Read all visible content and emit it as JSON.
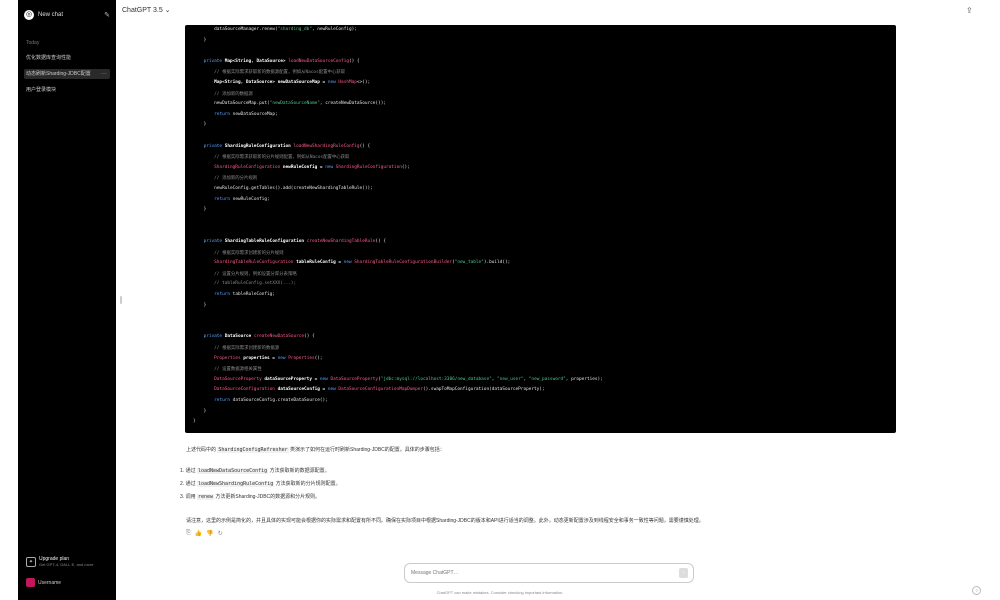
{
  "sidebar": {
    "logo": "◎",
    "new_chat": "New chat",
    "section_label": "Today",
    "items": [
      {
        "label": "优化数据库查询性能"
      },
      {
        "label": "动态刷新Sharding-JDBC配置"
      },
      {
        "label": "用户登录模块"
      }
    ],
    "upgrade_title": "Upgrade plan",
    "upgrade_sub": "Get GPT-4, DALL·E, and more",
    "user_name": "Username"
  },
  "header": {
    "model": "ChatGPT 3.5 ⌄"
  },
  "code_lines": [
    [
      {
        "t": "        dataSourceManager.renew(",
        "c": ""
      },
      {
        "t": "\"sharding_db\"",
        "c": "str"
      },
      {
        "t": ", newRuleConfig);",
        "c": ""
      }
    ],
    [
      {
        "t": "    }",
        "c": ""
      }
    ],
    [
      {
        "t": "",
        "c": ""
      }
    ],
    [
      {
        "t": "    private ",
        "c": "kw"
      },
      {
        "t": "Map<String, DataSource> ",
        "c": "ty"
      },
      {
        "t": "loadNewDataSourceConfig",
        "c": "fn"
      },
      {
        "t": "() {",
        "c": ""
      }
    ],
    [
      {
        "t": "        // 根据实际需求获取新的数据源配置，例如从Nacos配置中心获取",
        "c": "cm"
      }
    ],
    [
      {
        "t": "        Map<String, DataSource> newDataSourceMap = ",
        "c": "ty"
      },
      {
        "t": "new ",
        "c": "kw"
      },
      {
        "t": "HashMap",
        "c": "fn"
      },
      {
        "t": "<>();",
        "c": ""
      }
    ],
    [
      {
        "t": "        // 添加新的数据源",
        "c": "cm"
      }
    ],
    [
      {
        "t": "        newDataSourceMap.put(",
        "c": ""
      },
      {
        "t": "\"newDataSourceName\"",
        "c": "str"
      },
      {
        "t": ", createNewDataSource());",
        "c": ""
      }
    ],
    [
      {
        "t": "        ",
        "c": ""
      },
      {
        "t": "return ",
        "c": "kw"
      },
      {
        "t": "newDataSourceMap;",
        "c": ""
      }
    ],
    [
      {
        "t": "    }",
        "c": ""
      }
    ],
    [
      {
        "t": "",
        "c": ""
      }
    ],
    [
      {
        "t": "    private ",
        "c": "kw"
      },
      {
        "t": "ShardingRuleConfiguration ",
        "c": "ty"
      },
      {
        "t": "loadNewShardingRuleConfig",
        "c": "fn"
      },
      {
        "t": "() {",
        "c": ""
      }
    ],
    [
      {
        "t": "        // 根据实际需求获取新的分片规则配置，例如从Nacos配置中心获取",
        "c": "cm"
      }
    ],
    [
      {
        "t": "        ShardingRuleConfiguration ",
        "c": "fn"
      },
      {
        "t": "newRuleConfig = ",
        "c": "ty"
      },
      {
        "t": "new ",
        "c": "kw"
      },
      {
        "t": "ShardingRuleConfiguration",
        "c": "fn"
      },
      {
        "t": "();",
        "c": ""
      }
    ],
    [
      {
        "t": "        // 添加新的分片规则",
        "c": "cm"
      }
    ],
    [
      {
        "t": "        newRuleConfig.getTables().add(createNewShardingTableRule());",
        "c": ""
      }
    ],
    [
      {
        "t": "        ",
        "c": ""
      },
      {
        "t": "return ",
        "c": "kw"
      },
      {
        "t": "newRuleConfig;",
        "c": ""
      }
    ],
    [
      {
        "t": "    }",
        "c": ""
      }
    ],
    [
      {
        "t": "",
        "c": ""
      }
    ],
    [
      {
        "t": "",
        "c": ""
      }
    ],
    [
      {
        "t": "    private ",
        "c": "kw"
      },
      {
        "t": "ShardingTableRuleConfiguration ",
        "c": "ty"
      },
      {
        "t": "createNewShardingTableRule",
        "c": "fn"
      },
      {
        "t": "() {",
        "c": ""
      }
    ],
    [
      {
        "t": "        // 根据实际需求创建新的分片规则",
        "c": "cm"
      }
    ],
    [
      {
        "t": "        ShardingTableRuleConfiguration ",
        "c": "fn"
      },
      {
        "t": "tableRuleConfig = ",
        "c": "ty"
      },
      {
        "t": "new ",
        "c": "kw"
      },
      {
        "t": "ShardingTableRuleConfigurationBuilder",
        "c": "fn"
      },
      {
        "t": "(",
        "c": ""
      },
      {
        "t": "\"new_table\"",
        "c": "str"
      },
      {
        "t": ").build();",
        "c": ""
      }
    ],
    [
      {
        "t": "        // 设置分片规则，例如设置分库分表策略",
        "c": "cm"
      }
    ],
    [
      {
        "t": "        // tableRuleConfig.setXXX(...);",
        "c": "cm"
      }
    ],
    [
      {
        "t": "        ",
        "c": ""
      },
      {
        "t": "return ",
        "c": "kw"
      },
      {
        "t": "tableRuleConfig;",
        "c": ""
      }
    ],
    [
      {
        "t": "    }",
        "c": ""
      }
    ],
    [
      {
        "t": "",
        "c": ""
      }
    ],
    [
      {
        "t": "",
        "c": ""
      }
    ],
    [
      {
        "t": "    private ",
        "c": "kw"
      },
      {
        "t": "DataSource ",
        "c": "ty"
      },
      {
        "t": "createNewDataSource",
        "c": "fn"
      },
      {
        "t": "() {",
        "c": ""
      }
    ],
    [
      {
        "t": "        // 根据实际需求创建新的数据源",
        "c": "cm"
      }
    ],
    [
      {
        "t": "        Properties ",
        "c": "fn"
      },
      {
        "t": "properties = ",
        "c": "ty"
      },
      {
        "t": "new ",
        "c": "kw"
      },
      {
        "t": "Properties",
        "c": "fn"
      },
      {
        "t": "();",
        "c": ""
      }
    ],
    [
      {
        "t": "        // 设置数据源相关属性",
        "c": "cm"
      }
    ],
    [
      {
        "t": "        DataSourceProperty ",
        "c": "fn"
      },
      {
        "t": "dataSourceProperty = ",
        "c": "ty"
      },
      {
        "t": "new ",
        "c": "kw"
      },
      {
        "t": "DataSourceProperty",
        "c": "fn"
      },
      {
        "t": "(",
        "c": ""
      },
      {
        "t": "\"jdbc:mysql://localhost:3306/new_database\"",
        "c": "str"
      },
      {
        "t": ", ",
        "c": ""
      },
      {
        "t": "\"new_user\"",
        "c": "str"
      },
      {
        "t": ", ",
        "c": ""
      },
      {
        "t": "\"new_password\"",
        "c": "str"
      },
      {
        "t": ", properties);",
        "c": ""
      }
    ],
    [
      {
        "t": "        DataSourceConfiguration ",
        "c": "fn"
      },
      {
        "t": "dataSourceConfig = ",
        "c": "ty"
      },
      {
        "t": "new ",
        "c": "kw"
      },
      {
        "t": "DataSourceConfigurationMapDumper",
        "c": "fn"
      },
      {
        "t": "().swapToMapConfiguration(dataSourceProperty);",
        "c": ""
      }
    ],
    [
      {
        "t": "        ",
        "c": ""
      },
      {
        "t": "return ",
        "c": "kw"
      },
      {
        "t": "dataSourceConfig.createDataSource();",
        "c": ""
      }
    ],
    [
      {
        "t": "    }",
        "c": ""
      }
    ],
    [
      {
        "t": "}",
        "c": ""
      }
    ]
  ],
  "summary": {
    "pre": "上述代码中的 ",
    "code": "ShardingConfigRefresher",
    "post": " 类演示了如何在运行时刷新Sharding-JDBC的配置。具体的步骤包括："
  },
  "steps": [
    {
      "num": "1.",
      "pre": "通过 ",
      "code": "loadNewDataSourceConfig",
      "post": " 方法获取新的数据源配置。"
    },
    {
      "num": "2.",
      "pre": "通过 ",
      "code": "loadNewShardingRuleConfig",
      "post": " 方法获取新的分片规则配置。"
    },
    {
      "num": "3.",
      "pre": "调用 ",
      "code": "renew",
      "post": " 方法更新Sharding-JDBC的数据源和分片规则。"
    }
  ],
  "note": "请注意，这里的示例是简化的，并且具体的实现可能会根据你的实际需求和配置有所不同。确保在实际项目中根据Sharding-JDBC的版本和API进行适当的调整。此外，动态更新配置涉及到线程安全和事务一致性等问题，需要谨慎处理。",
  "actions": [
    "⎘",
    "👍",
    "👎",
    "↻"
  ],
  "input": {
    "placeholder": "Message ChatGPT…",
    "send": "↑"
  },
  "disclaimer": "ChatGPT can make mistakes. Consider checking important information.",
  "share_icon": "⇪",
  "help": "?"
}
